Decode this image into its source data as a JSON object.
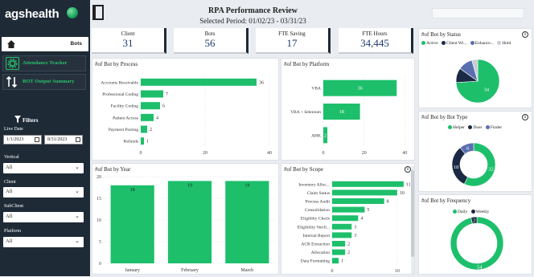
{
  "brand": {
    "name": "agshealth"
  },
  "nav": {
    "bots": "Bots",
    "attendance": "Attendance Tracker",
    "bot_output": "BOT Output Summary"
  },
  "filters": {
    "title": "Filters",
    "live_date_label": "Live Date",
    "date_from": "1/1/2023",
    "date_to": "8/31/2023",
    "vertical_label": "Vertical",
    "vertical_value": "All",
    "client_label": "Client",
    "client_value": "All",
    "subclient_label": "SubClient",
    "subclient_value": "All",
    "platform_label": "Platform",
    "platform_value": "All"
  },
  "header": {
    "title": "RPA Performance Review",
    "period": "Selected Period: 01/02/23 - 03/31/23"
  },
  "kpis": [
    {
      "label": "Client",
      "value": "31"
    },
    {
      "label": "Bots",
      "value": "56"
    },
    {
      "label": "FTE Saving",
      "value": "17"
    },
    {
      "label": "FTE Hours",
      "value": "34,445"
    }
  ],
  "colors": {
    "accent": "#1dbf6b",
    "navy": "#1e2a36",
    "dark": "#1a2a44",
    "blue": "#5a6fb0",
    "gray": "#c8ccd4"
  },
  "chart_data": [
    {
      "type": "bar",
      "orientation": "horizontal",
      "title": "#of Bot by Process",
      "categories": [
        "Accounts Receivable",
        "Professional Coding",
        "Facility Coding",
        "Patient Access",
        "Payment Posting",
        "Refunds"
      ],
      "values": [
        36,
        7,
        6,
        4,
        2,
        1
      ],
      "xticks": [
        0,
        20,
        40
      ],
      "xlim": [
        0,
        42
      ]
    },
    {
      "type": "bar",
      "orientation": "horizontal",
      "title": "#of Bot by Platform",
      "categories": [
        "VBA",
        "VBA + Selenium",
        "AHK"
      ],
      "values": [
        36,
        18,
        2
      ],
      "xticks": [
        0,
        20,
        40
      ],
      "xlim": [
        0,
        43
      ]
    },
    {
      "type": "bar",
      "orientation": "vertical",
      "title": "#of Bot by Year",
      "categories": [
        "January",
        "February",
        "March"
      ],
      "values": [
        18,
        19,
        19
      ],
      "yticks": [
        0,
        5,
        10,
        15,
        20
      ],
      "ylim": [
        0,
        20
      ]
    },
    {
      "type": "bar",
      "orientation": "horizontal",
      "title": "#of Bot by Scope",
      "categories": [
        "Inventory Alloc...",
        "Claim Status",
        "Process Audit",
        "Consolidation",
        "Eligiblity Check",
        "Eligibility Verifi...",
        "Internal Report",
        "ACR Extraction",
        "Allocation",
        "Data Formatting"
      ],
      "values": [
        11,
        10,
        8,
        5,
        4,
        3,
        3,
        2,
        2,
        1
      ],
      "xticks": [
        0,
        10
      ],
      "xlim": [
        0,
        12
      ]
    },
    {
      "type": "pie",
      "title": "#of Bot by Status",
      "donut": false,
      "legend": [
        "Active",
        "Client Wi...",
        "Enhance...",
        "Hold"
      ],
      "values": [
        34,
        5,
        5,
        2
      ],
      "colors": [
        "#1dbf6b",
        "#1a2a44",
        "#5a6fb0",
        "#c8ccd4"
      ],
      "labels": [
        "34",
        "",
        "",
        ""
      ]
    },
    {
      "type": "pie",
      "title": "#of Bot by Bot Type",
      "donut": true,
      "legend": [
        "Helper",
        "Doer",
        "Finder"
      ],
      "values": [
        32,
        18,
        6
      ],
      "colors": [
        "#1dbf6b",
        "#1a2a44",
        "#5a6fb0"
      ],
      "labels": [
        "32",
        "18",
        "6"
      ]
    },
    {
      "type": "pie",
      "title": "#of Bot by Frequency",
      "donut": true,
      "legend": [
        "Daily",
        "Weekly"
      ],
      "values": [
        54,
        2
      ],
      "colors": [
        "#1dbf6b",
        "#1a2a44"
      ],
      "labels": [
        "54",
        "2"
      ]
    }
  ]
}
